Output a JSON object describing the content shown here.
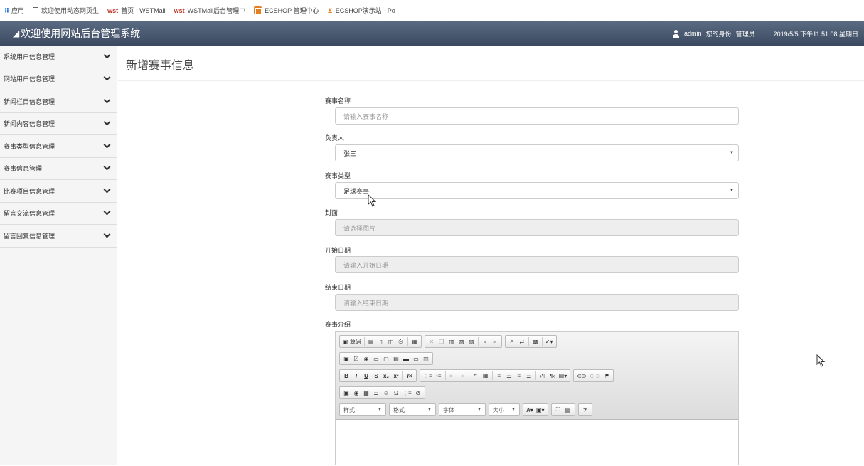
{
  "bookmarks": [
    {
      "icon": "apps-icon",
      "label": "应用"
    },
    {
      "icon": "document-icon",
      "label": "欢迎使用动态网页生"
    },
    {
      "icon": "wst-icon",
      "label": "首页 - WSTMall"
    },
    {
      "icon": "wst-icon",
      "label": "WSTMall后台管理中"
    },
    {
      "icon": "ecshop-icon",
      "label": "ECSHOP 管理中心"
    },
    {
      "icon": "cart-icon",
      "label": "ECSHOP演示站 - Po"
    }
  ],
  "header": {
    "title": "欢迎使用网站后台管理系统",
    "username": "admin",
    "role_label": "您的身份",
    "role": "管理员",
    "datetime": "2019/5/5 下午11:51:08 星期日"
  },
  "sidebar": {
    "items": [
      {
        "label": "系统用户信息管理"
      },
      {
        "label": "网站用户信息管理"
      },
      {
        "label": "新闻栏目信息管理"
      },
      {
        "label": "新闻内容信息管理"
      },
      {
        "label": "赛事类型信息管理"
      },
      {
        "label": "赛事信息管理"
      },
      {
        "label": "比赛项目信息管理"
      },
      {
        "label": "留言交流信息管理"
      },
      {
        "label": "留言回复信息管理"
      }
    ]
  },
  "main": {
    "title": "新增赛事信息",
    "fields": {
      "name": {
        "label": "赛事名称",
        "placeholder": "请输入赛事名称"
      },
      "manager": {
        "label": "负责人",
        "value": "张三"
      },
      "type": {
        "label": "赛事类型",
        "value": "足球赛事"
      },
      "cover": {
        "label": "封面",
        "placeholder": "请选择图片"
      },
      "start_date": {
        "label": "开始日期",
        "placeholder": "请输入开始日期"
      },
      "end_date": {
        "label": "结束日期",
        "placeholder": "请输入结束日期"
      },
      "intro": {
        "label": "赛事介绍"
      }
    },
    "editor": {
      "source_label": "源码",
      "style_select": "样式",
      "format_select": "格式",
      "font_select": "字体",
      "size_select": "大小",
      "help_label": "?"
    }
  }
}
